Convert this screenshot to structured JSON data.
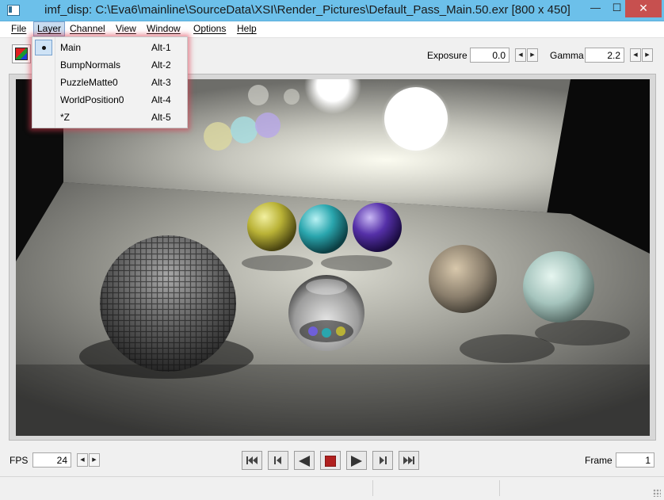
{
  "window": {
    "title": "imf_disp: C:\\Eva6\\mainline\\SourceData\\XSI\\Render_Pictures\\Default_Pass_Main.50.exr [800 x 450]",
    "minimize_glyph": "—",
    "maximize_glyph": "☐",
    "close_glyph": "✕"
  },
  "menubar": {
    "items": [
      {
        "label": "File"
      },
      {
        "label": "Layer"
      },
      {
        "label": "Channel"
      },
      {
        "label": "View"
      },
      {
        "label": "Window"
      },
      {
        "label": "Options"
      },
      {
        "label": "Help"
      }
    ],
    "active": "Layer"
  },
  "layer_menu": {
    "items": [
      {
        "label": "Main",
        "shortcut": "Alt-1",
        "checked": true
      },
      {
        "label": "BumpNormals",
        "shortcut": "Alt-2",
        "checked": false
      },
      {
        "label": "PuzzleMatte0",
        "shortcut": "Alt-3",
        "checked": false
      },
      {
        "label": "WorldPosition0",
        "shortcut": "Alt-4",
        "checked": false
      },
      {
        "label": "*Z",
        "shortcut": "Alt-5",
        "checked": false
      }
    ]
  },
  "toolbar": {
    "exposure_label": "Exposure",
    "exposure_value": "0.0",
    "gamma_label": "Gamma",
    "gamma_value": "2.2"
  },
  "playback": {
    "fps_label": "FPS",
    "fps_value": "24",
    "frame_label": "Frame",
    "frame_value": "1"
  },
  "colors": {
    "titlebar": "#6cc0ea",
    "close_button": "#c7504f",
    "stop_button": "#b0201f",
    "menu_highlight": "#c8dcef"
  }
}
